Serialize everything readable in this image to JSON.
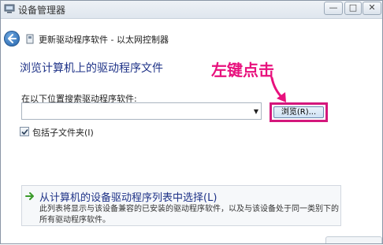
{
  "window": {
    "title": "设备管理器",
    "controls": {
      "minimize": "—",
      "maximize": "□",
      "close": "✕"
    }
  },
  "nav": {
    "title": "更新驱动程序软件 - 以太网控制器"
  },
  "content": {
    "heading": "浏览计算机上的驱动程序文件",
    "annotation": "左键点击",
    "search_label": "在以下位置搜索驱动程序软件:",
    "path_value": "",
    "browse_label": "浏览(R)...",
    "include_subfolders": {
      "label": "包括子文件夹(I)",
      "checked": true
    },
    "pick_option": {
      "title": "从计算机的设备驱动程序列表中选择(L)",
      "description": "此列表将显示与该设备兼容的已安装的驱动程序软件，以及与该设备处于同一类别下的所有驱动程序软件。"
    }
  },
  "colors": {
    "annotation": "#e8117d",
    "link": "#1e3287",
    "highlight_border": "#d4177c",
    "arrow_green": "#3a9a2a"
  }
}
